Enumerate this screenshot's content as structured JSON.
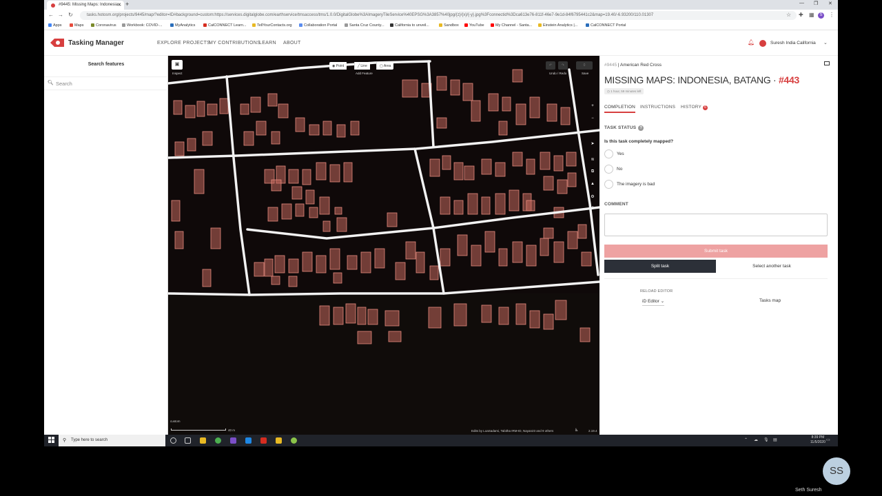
{
  "browser": {
    "tab_title": "#9445: Missing Maps: Indonesia...",
    "url": "tasks.hotosm.org/projects/9445/map/?editor=ID#background=custom:https://services.digitalglobe.com/earthservice/tmsaccess/tms/1.0.0/DigitalGlobe%3AImageryTileService%40EPSG%3A3857%40jpg/{z}/{x}/{-y}.jpg%3Fconnectid%3Dca613e76-811f-46e7-9e1d-84f6795441c2&map=19.40/-6.93200/110.01307",
    "bookmarks": [
      "Apps",
      "Maps",
      "Coronavirus",
      "Workbook: COVID-...",
      "MyAnalytics",
      "CalCONNECT Learn...",
      "TellYourContacts.org",
      "Collaboration Portal",
      "Santa Cruz County...",
      "California to unveil...",
      "Sandbox",
      "YouTube",
      "My Channel - Santa...",
      "Einstein Analytics |...",
      "CalCONNECT Portal"
    ]
  },
  "header": {
    "brand": "Tasking Manager",
    "nav": [
      "EXPLORE PROJECTS",
      "MY CONTRIBUTIONS",
      "LEARN",
      "ABOUT"
    ],
    "user": "Suresh India California"
  },
  "left_panel": {
    "title": "Search features",
    "search_placeholder": "Search"
  },
  "map": {
    "inspect_label": "Inspect",
    "tools": [
      "Point",
      "Line",
      "Area"
    ],
    "add_feature_label": "Add Feature",
    "undo_redo_label": "Undo / Redo",
    "save_label": "Save",
    "background_label": "custom",
    "scale_label": "40 m",
    "edits_credit": "Edits by LoaSadami, Tabitha IRM-ID, Nayan23 and 9 others",
    "version": "2.19.4"
  },
  "task": {
    "project_id": "#9445",
    "organization": "American Red Cross",
    "title": "MISSING MAPS: INDONESIA, BATANG · ",
    "task_id": "#443",
    "time_left": "1 hour, 59 minutes left",
    "tabs": [
      "COMPLETION",
      "INSTRUCTIONS",
      "HISTORY"
    ],
    "history_count": "6",
    "status_title": "TASK STATUS",
    "question": "Is this task completely mapped?",
    "options": [
      "Yes",
      "No",
      "The imagery is bad"
    ],
    "comment_label": "COMMENT",
    "submit_label": "Submit task",
    "split_label": "Split task",
    "another_label": "Select another task",
    "reload_label": "RELOAD EDITOR",
    "editor": "iD Editor",
    "tasks_map_label": "Tasks map"
  },
  "taskbar": {
    "search_placeholder": "Type here to search",
    "time": "8:39 PM",
    "date": "11/5/2020"
  },
  "participant": {
    "initials": "SS",
    "name": "Seth Suresh"
  }
}
